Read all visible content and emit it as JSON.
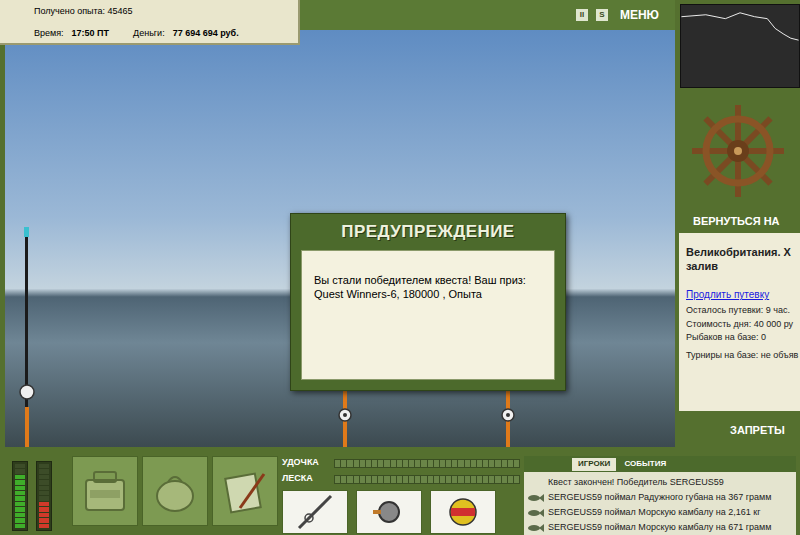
{
  "stats": {
    "experience": "Получено опыта: 45465",
    "time_label": "Время:",
    "time": "17:50 ПТ",
    "money_label": "Деньги:",
    "money": "77 694 694 руб."
  },
  "toolbar": {
    "buttons": [
      "II",
      "S"
    ],
    "menu": "МЕНЮ"
  },
  "dialog": {
    "title": "ПРЕДУПРЕЖДЕНИЕ",
    "message": "Вы стали победителем квеста! Ваш приз: Quest Winners-6, 180000 , Опыта"
  },
  "side_panel": {
    "return_button": "ВЕРНУТЬСЯ НА",
    "location_lines": [
      "Великобритания. Х",
      "залив"
    ],
    "extend_link": "Продлить путевку",
    "info": [
      "Осталось путевки: 9 час.",
      "Стоимость дня: 40 000 ру",
      "Рыбаков на базе: 0",
      "Турниры на базе: не объяв"
    ],
    "bans_button": "ЗАПРЕТЫ"
  },
  "gauges": [
    {
      "name": "energy",
      "level": 0.85,
      "color": "#3fae2a"
    },
    {
      "name": "tension",
      "level": 0.4,
      "color": "#d03a2a"
    }
  ],
  "tackle_bars": [
    {
      "label": "УДОЧКА",
      "level": 0
    },
    {
      "label": "ЛЕСКА",
      "level": 0
    }
  ],
  "chat": {
    "tabs": [
      {
        "label": "ИГРОКИ",
        "selected": true
      },
      {
        "label": "СОБЫТИЯ",
        "selected": false
      }
    ],
    "messages": [
      {
        "kind": "system",
        "text": "Квест закончен! Победитель SERGEUS59"
      },
      {
        "kind": "catch",
        "text": "SERGEUS59 поймал Радужного губана на 367 грамм"
      },
      {
        "kind": "catch",
        "text": "SERGEUS59 поймал Морскую камбалу на 2,161 кг"
      },
      {
        "kind": "catch",
        "text": "SERGEUS59 поймал Морскую камбалу на 671 грамм"
      }
    ]
  }
}
